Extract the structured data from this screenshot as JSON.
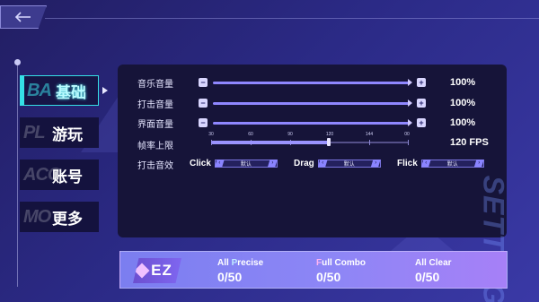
{
  "header": {
    "back_icon": "back-arrow-icon"
  },
  "nav": {
    "items": [
      {
        "ghost": "BA",
        "label": "基础",
        "active": true
      },
      {
        "ghost": "PL",
        "label": "游玩",
        "active": false
      },
      {
        "ghost": "ACC",
        "label": "账号",
        "active": false
      },
      {
        "ghost": "MO",
        "label": "更多",
        "active": false
      }
    ]
  },
  "settings": {
    "music_volume": {
      "label": "音乐音量",
      "value": "100%",
      "level": 1.0
    },
    "hit_volume": {
      "label": "打击音量",
      "value": "100%",
      "level": 1.0
    },
    "ui_volume": {
      "label": "界面音量",
      "value": "100%",
      "level": 1.0
    },
    "fps_limit": {
      "label": "帧率上限",
      "value": "120 FPS",
      "ticks": [
        "30",
        "60",
        "90",
        "120",
        "144",
        "00"
      ],
      "selected_index": 3
    },
    "hit_sound": {
      "label": "打击音效",
      "groups": [
        {
          "name": "Click",
          "value": "默认"
        },
        {
          "name": "Drag",
          "value": "默认"
        },
        {
          "name": "Flick",
          "value": "默认"
        }
      ]
    }
  },
  "watermark": "SETTING",
  "stats": {
    "difficulty": "EZ",
    "all_precise": {
      "label_first": "All ",
      "label_hl": "P",
      "label_rest": "recise",
      "value": "0/50"
    },
    "full_combo": {
      "label_first": "",
      "label_hl": "F",
      "label_rest": "ull Combo",
      "value": "0/50"
    },
    "all_clear": {
      "label_first": "All Clear",
      "label_hl": "",
      "label_rest": "",
      "value": "0/50"
    }
  },
  "colors": {
    "accent_cyan": "#35e0e6",
    "slider": "#8f87ff",
    "panel": "#161439",
    "bg": "#2b2a86"
  }
}
